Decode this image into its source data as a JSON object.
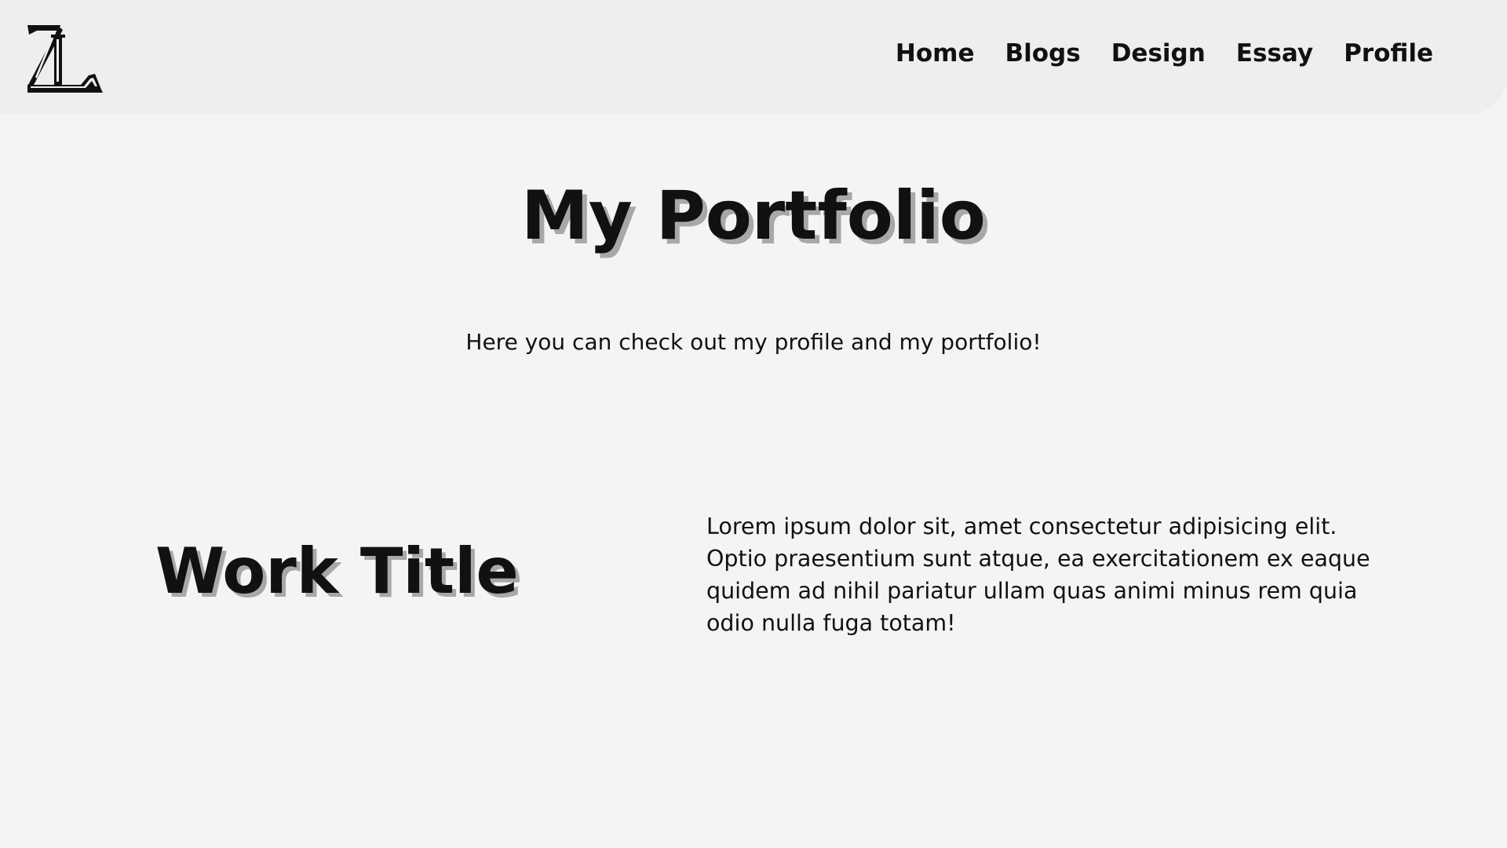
{
  "header": {
    "logo_text": "ZL",
    "nav": [
      {
        "label": "Home"
      },
      {
        "label": "Blogs"
      },
      {
        "label": "Design"
      },
      {
        "label": "Essay"
      },
      {
        "label": "Profile"
      }
    ]
  },
  "hero": {
    "title": "My Portfolio",
    "subtitle": "Here you can check out my profile and my portfolio!"
  },
  "work": {
    "title": "Work Title",
    "description": "Lorem ipsum dolor sit, amet consectetur adipisicing elit. Optio praesentium sunt atque, ea exercitationem ex eaque quidem ad nihil pariatur ullam quas animi minus rem quia odio nulla fuga totam!"
  },
  "colors": {
    "background": "#f4f4f4",
    "header_background": "#eeeeee",
    "text": "#111111",
    "text_shadow": "#a8a8a8"
  }
}
